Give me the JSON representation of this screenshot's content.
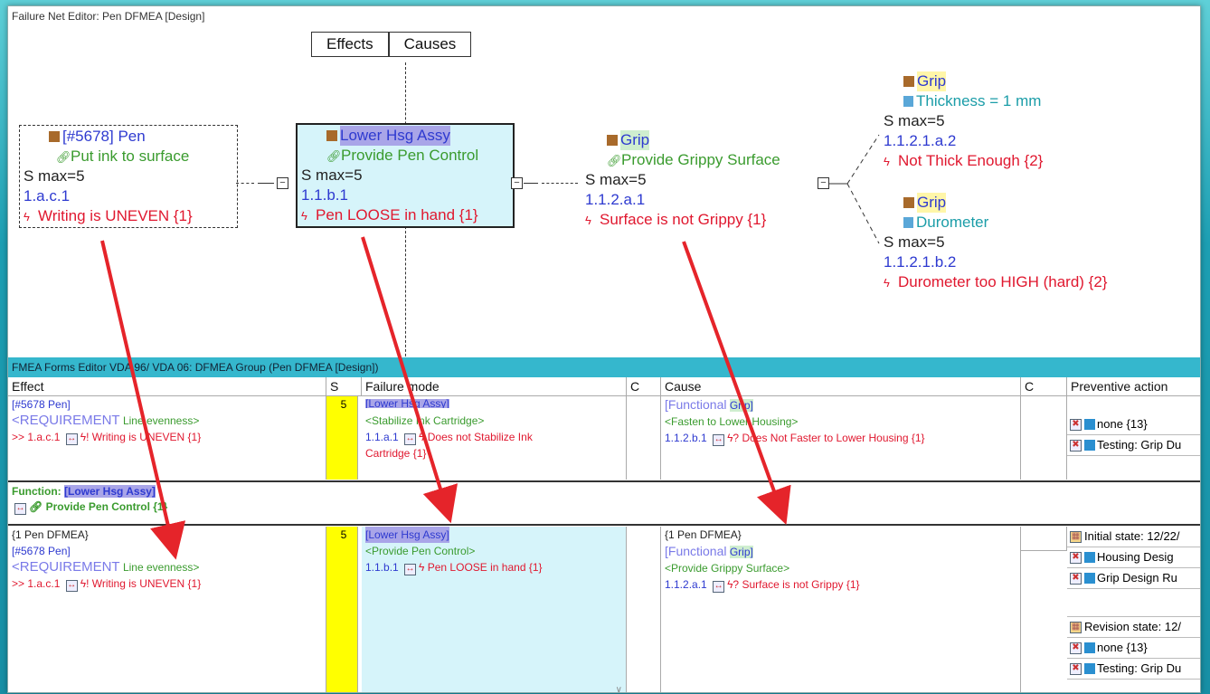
{
  "window_title": "Failure Net Editor: Pen DFMEA [Design]",
  "tabs": {
    "effects": "Effects",
    "causes": "Causes"
  },
  "net": {
    "effect_node": {
      "label": "[#5678]  Pen",
      "function": "Put ink to surface",
      "smax": "S max=5",
      "id": "1.a.c.1",
      "failure": "Writing is UNEVEN {1}"
    },
    "focus_node": {
      "label": "Lower Hsg Assy",
      "function": "Provide Pen Control",
      "smax": "S max=5",
      "id": "1.1.b.1",
      "failure": "Pen LOOSE in hand {1}"
    },
    "cause_node": {
      "label": "Grip",
      "function": "Provide Grippy Surface",
      "smax": "S max=5",
      "id": "1.1.2.a.1",
      "failure": "Surface is not Grippy {1}"
    },
    "sub_cause_1": {
      "label": "Grip",
      "char": "Thickness = 1 mm",
      "smax": "S max=5",
      "id": "1.1.2.1.a.2",
      "failure": "Not Thick Enough {2}"
    },
    "sub_cause_2": {
      "label": "Grip",
      "char": "Durometer",
      "smax": "S max=5",
      "id": "1.1.2.1.b.2",
      "failure": "Durometer too HIGH (hard) {2}"
    }
  },
  "forms": {
    "header": "FMEA Forms Editor VDA 96/ VDA 06: DFMEA Group (Pen DFMEA [Design])",
    "columns": {
      "effect": "Effect",
      "s": "S",
      "failure_mode": "Failure mode",
      "c1": "C",
      "cause": "Cause",
      "c2": "C",
      "preventive": "Preventive action"
    },
    "row1": {
      "effect_l1": "[#5678 Pen]",
      "effect_req": "<REQUIREMENT",
      "effect_req2": "Line evenness>",
      "effect_fail_id": ">> 1.a.c.1",
      "effect_fail": "Writing is UNEVEN {1}",
      "sev": "5",
      "fm_l0": "[Lower Hsg Assy]",
      "fm_l1": "<Stabilize Ink Cartridge>",
      "fm_l2_id": "1.1.a.1",
      "fm_l2": "Does not Stabilize Ink",
      "fm_l3": "Cartridge {1}",
      "cause_l1a": "[Functional",
      "cause_l1b": "Grip]",
      "cause_l2": "<Fasten to Lower Housing>",
      "cause_l3_id": "1.1.2.b.1",
      "cause_l3": "Does Not Faster to Lower Housing {1}",
      "pa1": "none {13}",
      "pa2": "Testing: Grip Du"
    },
    "function_row": {
      "label": "Function:",
      "name": "[Lower Hsg Assy]",
      "func": "Provide Pen Control {1}"
    },
    "row2": {
      "effect_l0": "{1 Pen DFMEA}",
      "effect_l1": "[#5678 Pen]",
      "effect_req": "<REQUIREMENT",
      "effect_req2": "Line evenness>",
      "effect_fail_id": ">> 1.a.c.1",
      "effect_fail": "Writing is UNEVEN {1}",
      "sev": "5",
      "fm_l0": "[Lower Hsg Assy]",
      "fm_l1": "<Provide Pen Control>",
      "fm_l2_id": "1.1.b.1",
      "fm_l2": "Pen LOOSE in hand {1}",
      "cause_l0": "{1 Pen DFMEA}",
      "cause_l1a": "[Functional",
      "cause_l1b": "Grip]",
      "cause_l2": "<Provide Grippy Surface>",
      "cause_l3_id": "1.1.2.a.1",
      "cause_l3": "Surface is not Grippy {1}",
      "pa_initial": "Initial state: 12/22/",
      "pa1": "Housing Desig",
      "pa2": "Grip Design Ru",
      "pa_revision": "Revision state: 12/",
      "pa3": "none {13}",
      "pa4": "Testing: Grip Du"
    }
  }
}
